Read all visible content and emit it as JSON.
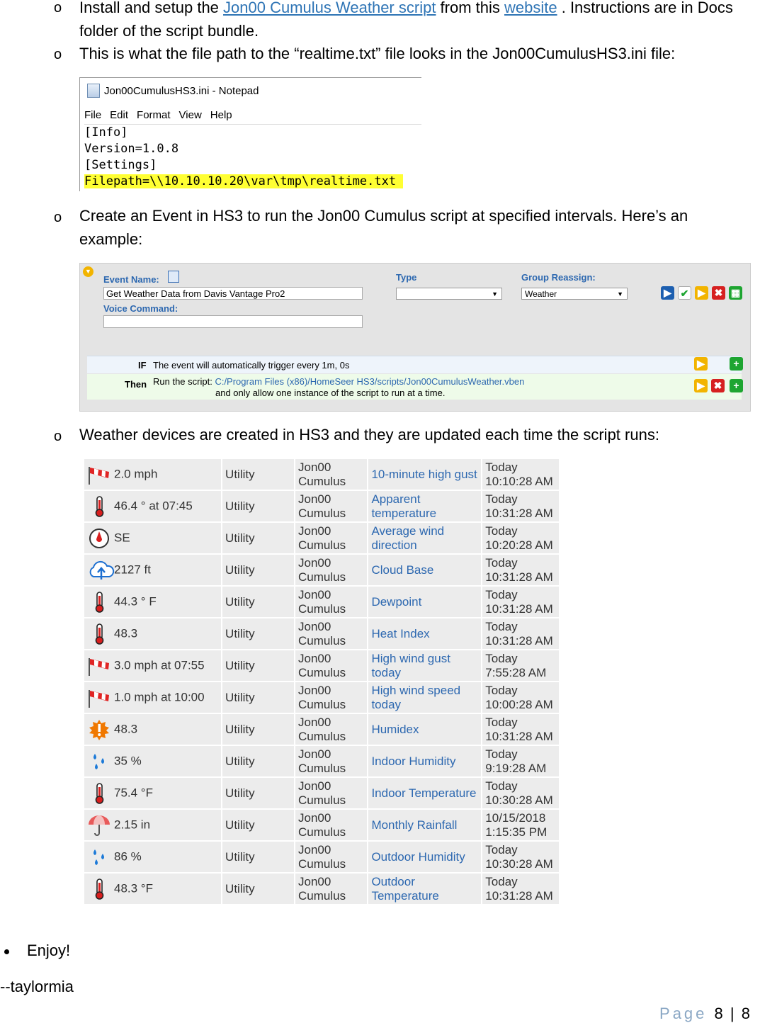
{
  "steps": [
    {
      "pre": "Install and setup the ",
      "link1": "Jon00 Cumulus Weather script",
      "mid": " from this ",
      "link2": "website",
      "post": " . Instructions are in Docs",
      "line2": "folder of the script bundle."
    },
    {
      "text": "This is what the file path to the “realtime.txt” file looks in the Jon00CumulusHS3.ini file:"
    },
    {
      "line1": "Create an Event in HS3 to run the Jon00 Cumulus script at specified intervals. Here’s an",
      "line2": "example:"
    },
    {
      "text": "Weather devices are created in HS3 and they are updated each time the script runs:"
    }
  ],
  "bullet_glyph": "o",
  "notepad": {
    "title_file": "Jon00CumulusHS3.ini",
    "title_sep": " - ",
    "title_app": "Notepad",
    "menu": [
      "File",
      "Edit",
      "Format",
      "View",
      "Help"
    ],
    "lines": [
      "[Info]",
      "Version=1.0.8",
      "[Settings]"
    ],
    "highlight_line": "Filepath=\\\\10.10.10.20\\var\\tmp\\realtime.txt"
  },
  "event": {
    "name_label": "Event Name:",
    "name_value": "Get Weather Data from Davis Vantage Pro2",
    "voice_label": "Voice Command:",
    "voice_value": "",
    "type_label": "Type",
    "type_value": "",
    "group_label": "Group Reassign:",
    "group_value": "Weather",
    "if_label": "IF",
    "if_text": "The event will automatically trigger every 1m, 0s",
    "then_label": "Then",
    "then_pre": "Run the script: ",
    "then_path": "C:/Program Files (x86)/HomeSeer HS3/scripts/Jon00CumulusWeather.vben",
    "then_line2": "and only allow one instance of the script to run at a time."
  },
  "devices": [
    {
      "icon": "windsock-icon",
      "value": "2.0 mph",
      "location": "Utility",
      "loc2a": "Jon00",
      "loc2b": "Cumulus",
      "name": "10-minute high gust",
      "date": "Today",
      "time": "10:10:28 AM"
    },
    {
      "icon": "thermometer-icon",
      "value": "46.4 ° at 07:45",
      "location": "Utility",
      "loc2a": "Jon00",
      "loc2b": "Cumulus",
      "name": "Apparent temperature",
      "date": "Today",
      "time": "10:31:28 AM"
    },
    {
      "icon": "compass-icon",
      "value": "SE",
      "location": "Utility",
      "loc2a": "Jon00",
      "loc2b": "Cumulus",
      "name": "Average wind direction",
      "date": "Today",
      "time": "10:20:28 AM"
    },
    {
      "icon": "cloud-icon",
      "value": "2127 ft",
      "location": "Utility",
      "loc2a": "Jon00",
      "loc2b": "Cumulus",
      "name": "Cloud Base",
      "date": "Today",
      "time": "10:31:28 AM"
    },
    {
      "icon": "thermometer-icon",
      "value": "44.3 ° F",
      "location": "Utility",
      "loc2a": "Jon00",
      "loc2b": "Cumulus",
      "name": "Dewpoint",
      "date": "Today",
      "time": "10:31:28 AM"
    },
    {
      "icon": "thermometer-icon",
      "value": "48.3",
      "location": "Utility",
      "loc2a": "Jon00",
      "loc2b": "Cumulus",
      "name": "Heat Index",
      "date": "Today",
      "time": "10:31:28 AM"
    },
    {
      "icon": "windsock-icon",
      "value": "3.0 mph at 07:55",
      "location": "Utility",
      "loc2a": "Jon00",
      "loc2b": "Cumulus",
      "name": "High wind gust today",
      "date": "Today",
      "time": "7:55:28 AM"
    },
    {
      "icon": "windsock-icon",
      "value": "1.0 mph at 10:00",
      "location": "Utility",
      "loc2a": "Jon00",
      "loc2b": "Cumulus",
      "name": "High wind speed today",
      "date": "Today",
      "time": "10:00:28 AM"
    },
    {
      "icon": "humidex-icon",
      "value": "48.3",
      "location": "Utility",
      "loc2a": "Jon00",
      "loc2b": "Cumulus",
      "name": "Humidex",
      "date": "Today",
      "time": "10:31:28 AM"
    },
    {
      "icon": "droplets-icon",
      "value": "35 %",
      "location": "Utility",
      "loc2a": "Jon00",
      "loc2b": "Cumulus",
      "name": "Indoor Humidity",
      "date": "Today",
      "time": "9:19:28 AM"
    },
    {
      "icon": "thermometer-icon",
      "value": "75.4 °F",
      "location": "Utility",
      "loc2a": "Jon00",
      "loc2b": "Cumulus",
      "name": "Indoor Temperature",
      "date": "Today",
      "time": "10:30:28 AM"
    },
    {
      "icon": "umbrella-icon",
      "value": "2.15 in",
      "location": "Utility",
      "loc2a": "Jon00",
      "loc2b": "Cumulus",
      "name": "Monthly Rainfall",
      "date": "10/15/2018",
      "time": "1:15:35 PM"
    },
    {
      "icon": "droplets-icon",
      "value": "86 %",
      "location": "Utility",
      "loc2a": "Jon00",
      "loc2b": "Cumulus",
      "name": "Outdoor Humidity",
      "date": "Today",
      "time": "10:30:28 AM"
    },
    {
      "icon": "thermometer-icon",
      "value": "48.3 °F",
      "location": "Utility",
      "loc2a": "Jon00",
      "loc2b": "Cumulus",
      "name": "Outdoor Temperature",
      "date": "Today",
      "time": "10:31:28 AM"
    }
  ],
  "enjoy": "Enjoy!",
  "signature": "--taylormia",
  "footer": {
    "label": "Page",
    "sep": "|",
    "page": "8",
    "total": "8"
  }
}
